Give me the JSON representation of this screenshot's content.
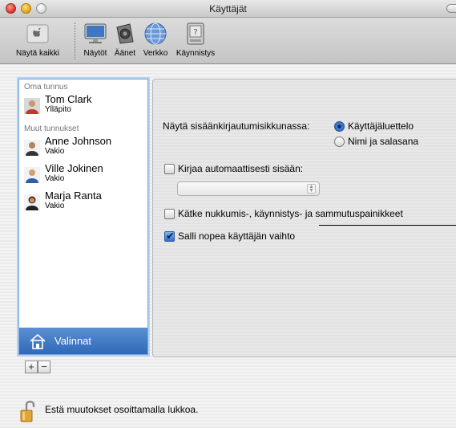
{
  "window": {
    "title": "Käyttäjät"
  },
  "toolbar": {
    "items": [
      {
        "label": "Näytä kaikki",
        "icon": "apple-icon"
      },
      {
        "label": "Näytöt",
        "icon": "display-icon"
      },
      {
        "label": "Äänet",
        "icon": "speaker-icon"
      },
      {
        "label": "Verkko",
        "icon": "globe-icon"
      },
      {
        "label": "Käynnistys",
        "icon": "startup-disk-icon"
      }
    ]
  },
  "sidebar": {
    "my_account_label": "Oma tunnus",
    "my_account": {
      "name": "Tom Clark",
      "role": "Ylläpito"
    },
    "other_accounts_label": "Muut tunnukset",
    "other_accounts": [
      {
        "name": "Anne Johnson",
        "role": "Vakio"
      },
      {
        "name": "Ville Jokinen",
        "role": "Vakio"
      },
      {
        "name": "Marja Ranta",
        "role": "Vakio"
      }
    ],
    "options_label": "Valinnat"
  },
  "buttons": {
    "add": "+",
    "remove": "−"
  },
  "login_options": {
    "display_label": "Näytä sisäänkirjautumisikkunassa:",
    "radio_list": "Käyttäjäluettelo",
    "radio_name_password": "Nimi ja salasana",
    "auto_login": "Kirjaa automaattisesti sisään:",
    "auto_login_user": "",
    "hide_buttons": "Kätke nukkumis-, käynnistys- ja sammutuspainikkeet",
    "fast_user_switching": "Salli nopea käyttäjän vaihto"
  },
  "lock": {
    "text": "Estä muutokset osoittamalla lukkoa."
  }
}
